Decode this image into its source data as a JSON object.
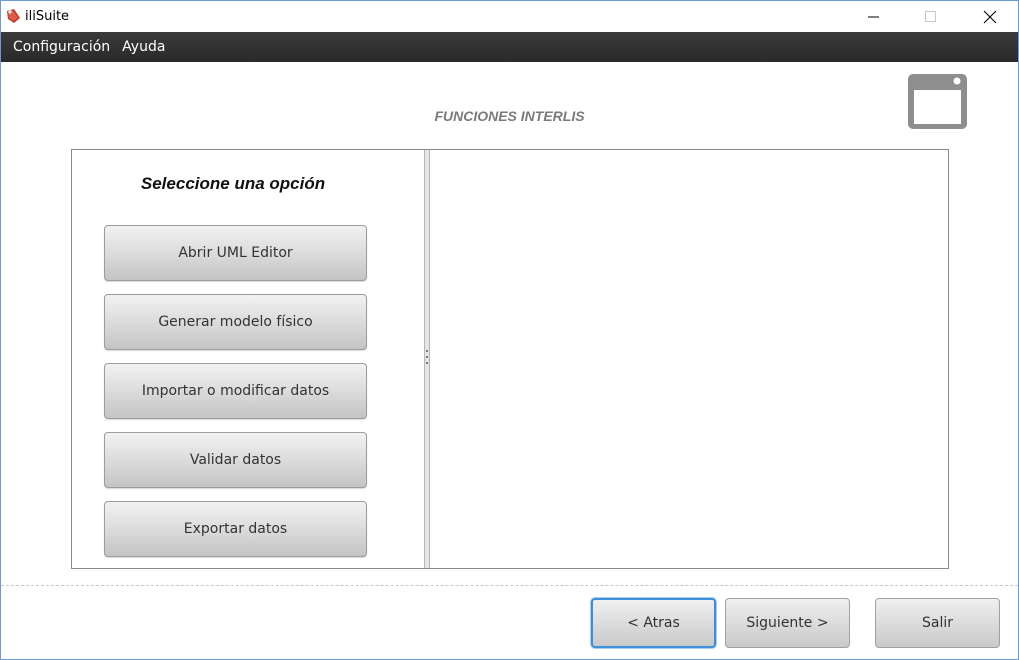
{
  "window": {
    "title": "iliSuite"
  },
  "menu": {
    "items": [
      "Configuración",
      "Ayuda"
    ]
  },
  "header": {
    "title": "FUNCIONES INTERLIS"
  },
  "left_panel": {
    "title": "Seleccione una opción",
    "options": [
      "Abrir UML Editor",
      "Generar modelo físico",
      "Importar o modificar datos",
      "Validar datos",
      "Exportar datos"
    ]
  },
  "footer": {
    "back_label": "< Atras",
    "next_label": "Siguiente >",
    "exit_label": "Salir"
  },
  "colors": {
    "menubar": "#2f2f2f",
    "heading": "#7a7a7a",
    "focus_border": "#3c8fd9",
    "app_icon": "#c0392b"
  },
  "icons": {
    "app": "ilisuite-logo-icon",
    "minimize": "minimize-icon",
    "maximize": "maximize-icon",
    "close": "close-icon",
    "window": "window-icon"
  }
}
